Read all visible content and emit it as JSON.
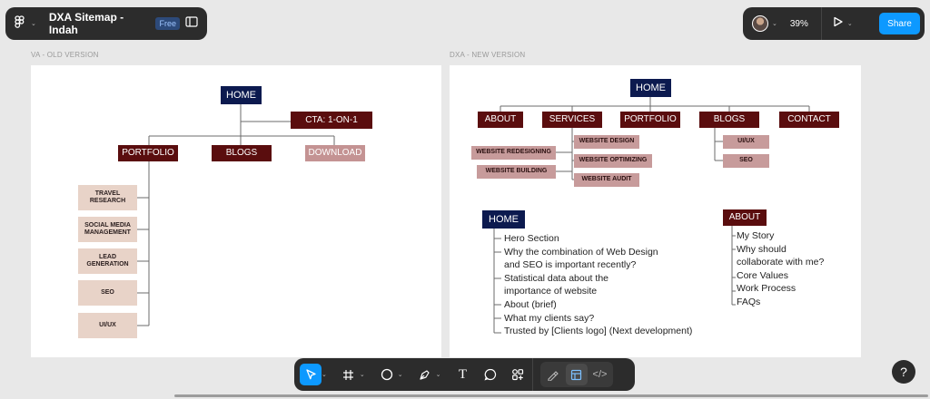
{
  "header": {
    "file_title": "DXA Sitemap - Indah",
    "plan_badge": "Free",
    "zoom_level": "39%",
    "share_label": "Share"
  },
  "frames": {
    "old_label": "VA - OLD VERSION",
    "new_label": "DXA - NEW VERSION"
  },
  "old_sitemap": {
    "home": "HOME",
    "cta": "CTA: 1-ON-1",
    "portfolio": "PORTFOLIO",
    "blogs": "BLOGS",
    "download": "DOWNLOAD",
    "portfolio_items": [
      "TRAVEL RESEARCH",
      "SOCIAL MEDIA MANAGEMENT",
      "LEAD GENERATION",
      "SEO",
      "UI/UX"
    ]
  },
  "new_sitemap": {
    "home": "HOME",
    "about": "ABOUT",
    "services": "SERVICES",
    "portfolio": "PORTFOLIO",
    "blogs": "BLOGS",
    "contact": "CONTACT",
    "services_left": [
      "WEBSITE REDESIGNING",
      "WEBSITE BUILDING"
    ],
    "services_right": [
      "WEBSITE DESIGN",
      "WEBSITE OPTIMIZING",
      "WEBSITE AUDIT"
    ],
    "blog_items": [
      "UI/UX",
      "SEO"
    ],
    "home_detail_title": "HOME",
    "home_sections": [
      "Hero Section",
      "Why the combination of Web Design",
      "and SEO is important recently?",
      "Statistical data about the",
      "importance of website",
      "About (brief)",
      "What my clients say?",
      "Trusted by [Clients logo] (Next development)"
    ],
    "about_detail_title": "ABOUT",
    "about_sections": [
      "My Story",
      "Why  should",
      "collaborate with me?",
      "Core Values",
      "Work Process",
      "FAQs"
    ]
  },
  "help_label": "?"
}
